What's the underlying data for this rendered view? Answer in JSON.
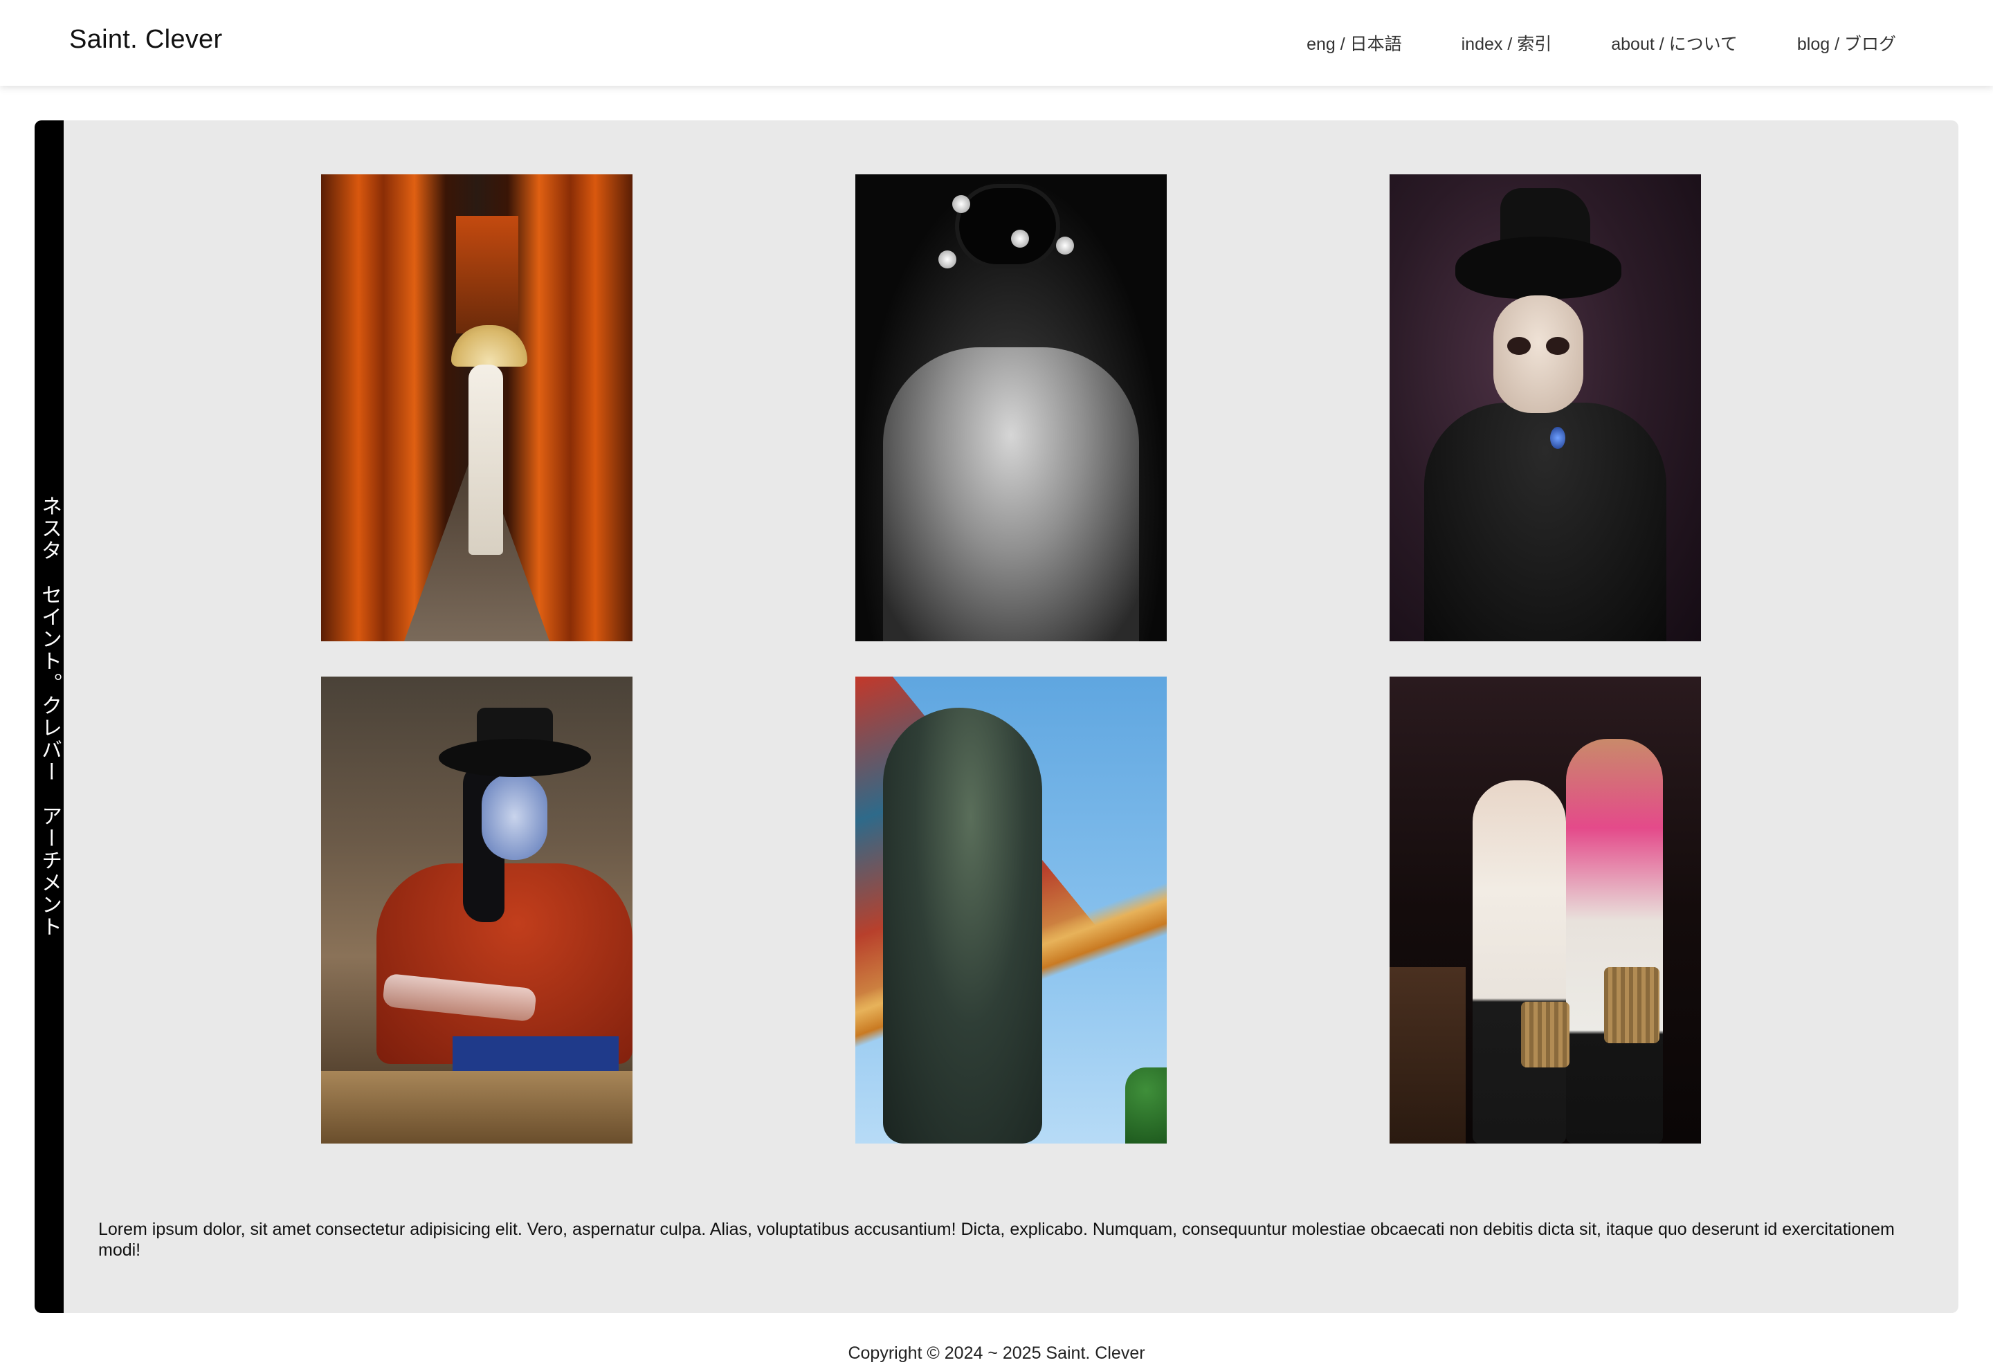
{
  "header": {
    "brand": "Saint. Clever",
    "nav": [
      {
        "label": "eng / 日本語"
      },
      {
        "label": "index / 索引"
      },
      {
        "label": "about / について"
      },
      {
        "label": "blog / ブログ"
      }
    ]
  },
  "sidebar": {
    "vertical_text": "ネスタ　セイント。クレバー　アーチメント"
  },
  "gallery": {
    "photos": [
      {
        "name": "torii-gates-photo"
      },
      {
        "name": "geisha-photo"
      },
      {
        "name": "skull-makeup-photo"
      },
      {
        "name": "red-shirt-woman-photo"
      },
      {
        "name": "lion-statue-photo"
      },
      {
        "name": "two-women-photo"
      }
    ]
  },
  "caption": "Lorem ipsum dolor, sit amet consectetur adipisicing elit. Vero, aspernatur culpa. Alias, voluptatibus accusantium! Dicta, explicabo. Numquam, consequuntur molestiae obcaecati non debitis dicta sit, itaque quo deserunt id exercitationem modi!",
  "footer": {
    "copyright": "Copyright © 2024 ~ 2025 Saint. Clever"
  },
  "colors": {
    "panel_bg": "#e9e9e9",
    "strip": "#000000",
    "header_bg": "#ffffff"
  }
}
